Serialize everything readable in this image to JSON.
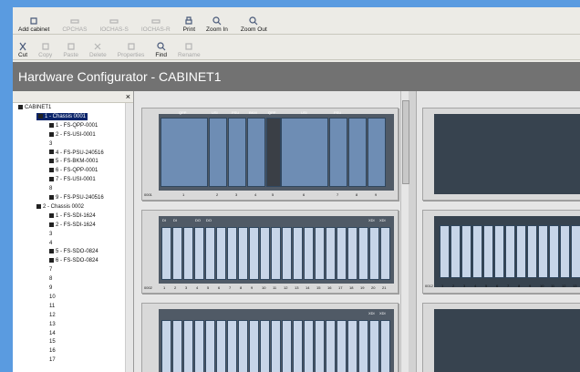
{
  "toolbar1": [
    {
      "label": "Add cabinet",
      "enabled": true,
      "icon": "add-cabinet-icon"
    },
    {
      "label": "CPCHAS",
      "enabled": false,
      "icon": "chassis-icon"
    },
    {
      "label": "IOCHAS-S",
      "enabled": false,
      "icon": "chassis-icon"
    },
    {
      "label": "IOCHAS-R",
      "enabled": false,
      "icon": "chassis-icon"
    },
    {
      "label": "Print",
      "enabled": true,
      "icon": "print-icon"
    },
    {
      "label": "Zoom In",
      "enabled": true,
      "icon": "zoom-in-icon"
    },
    {
      "label": "Zoom Out",
      "enabled": true,
      "icon": "zoom-out-icon"
    }
  ],
  "toolbar2": [
    {
      "label": "Cut",
      "enabled": true,
      "icon": "cut-icon"
    },
    {
      "label": "Copy",
      "enabled": false,
      "icon": "copy-icon"
    },
    {
      "label": "Paste",
      "enabled": false,
      "icon": "paste-icon"
    },
    {
      "label": "Delete",
      "enabled": false,
      "icon": "delete-icon"
    },
    {
      "label": "Properties",
      "enabled": false,
      "icon": "properties-icon"
    },
    {
      "label": "Find",
      "enabled": true,
      "icon": "find-icon"
    },
    {
      "label": "Rename",
      "enabled": false,
      "icon": "rename-icon"
    }
  ],
  "title": "Hardware Configurator - CABINET1",
  "tree_close": "×",
  "tree": [
    {
      "label": "CABINET1",
      "level": 0,
      "selected": false
    },
    {
      "label": "1 - Chassis 0001",
      "level": 1,
      "selected": true
    },
    {
      "label": "1 - FS-QPP-0001",
      "level": 2
    },
    {
      "label": "2 - FS-USI-0001",
      "level": 2
    },
    {
      "label": "3",
      "level": 2
    },
    {
      "label": "4 - FS-PSU-240516",
      "level": 2
    },
    {
      "label": "5 - FS-BKM-0001",
      "level": 2
    },
    {
      "label": "6 - FS-QPP-0001",
      "level": 2
    },
    {
      "label": "7 - FS-USI-0001",
      "level": 2
    },
    {
      "label": "8",
      "level": 2
    },
    {
      "label": "9 - FS-PSU-240516",
      "level": 2
    },
    {
      "label": "2 - Chassis 0002",
      "level": 1
    },
    {
      "label": "1 - FS-SDI-1624",
      "level": 2
    },
    {
      "label": "2 - FS-SDI-1624",
      "level": 2
    },
    {
      "label": "3",
      "level": 2
    },
    {
      "label": "4",
      "level": 2
    },
    {
      "label": "5 - FS-SDO-0824",
      "level": 2
    },
    {
      "label": "6 - FS-SDO-0824",
      "level": 2
    },
    {
      "label": "7",
      "level": 2
    },
    {
      "label": "8",
      "level": 2
    },
    {
      "label": "9",
      "level": 2
    },
    {
      "label": "10",
      "level": 2
    },
    {
      "label": "11",
      "level": 2
    },
    {
      "label": "12",
      "level": 2
    },
    {
      "label": "13",
      "level": 2
    },
    {
      "label": "14",
      "level": 2
    },
    {
      "label": "15",
      "level": 2
    },
    {
      "label": "16",
      "level": 2
    },
    {
      "label": "17",
      "level": 2
    }
  ],
  "chassis1": {
    "id": "0001",
    "headers": [
      "QPP",
      "USI",
      "PSU",
      "BKM",
      "QPP",
      "USI",
      "PSU"
    ],
    "slot_numbers": [
      "1",
      "2",
      "3",
      "4",
      "5",
      "6",
      "7",
      "8",
      "9"
    ]
  },
  "chassis2": {
    "id": "0002",
    "headers": [
      "DI",
      "DI",
      "DO",
      "DO",
      "XDI",
      "XDI"
    ],
    "slot_numbers": [
      "1",
      "2",
      "3",
      "4",
      "5",
      "6",
      "7",
      "8",
      "9",
      "10",
      "11",
      "12",
      "13",
      "14",
      "15",
      "16",
      "17",
      "18",
      "19",
      "20",
      "21"
    ]
  },
  "chassis3": {
    "headers": [
      "XDI",
      "XDI"
    ]
  },
  "chassis_right": {
    "id": "0012",
    "slot_numbers": [
      "1",
      "2",
      "3",
      "4",
      "5",
      "6",
      "7",
      "8",
      "9",
      "10",
      "11",
      "12",
      "13"
    ]
  },
  "colors": {
    "title_bar": "#727272",
    "module": "#6e8db4",
    "selected": "#0a246a",
    "window_bg": "#ecebe6"
  }
}
